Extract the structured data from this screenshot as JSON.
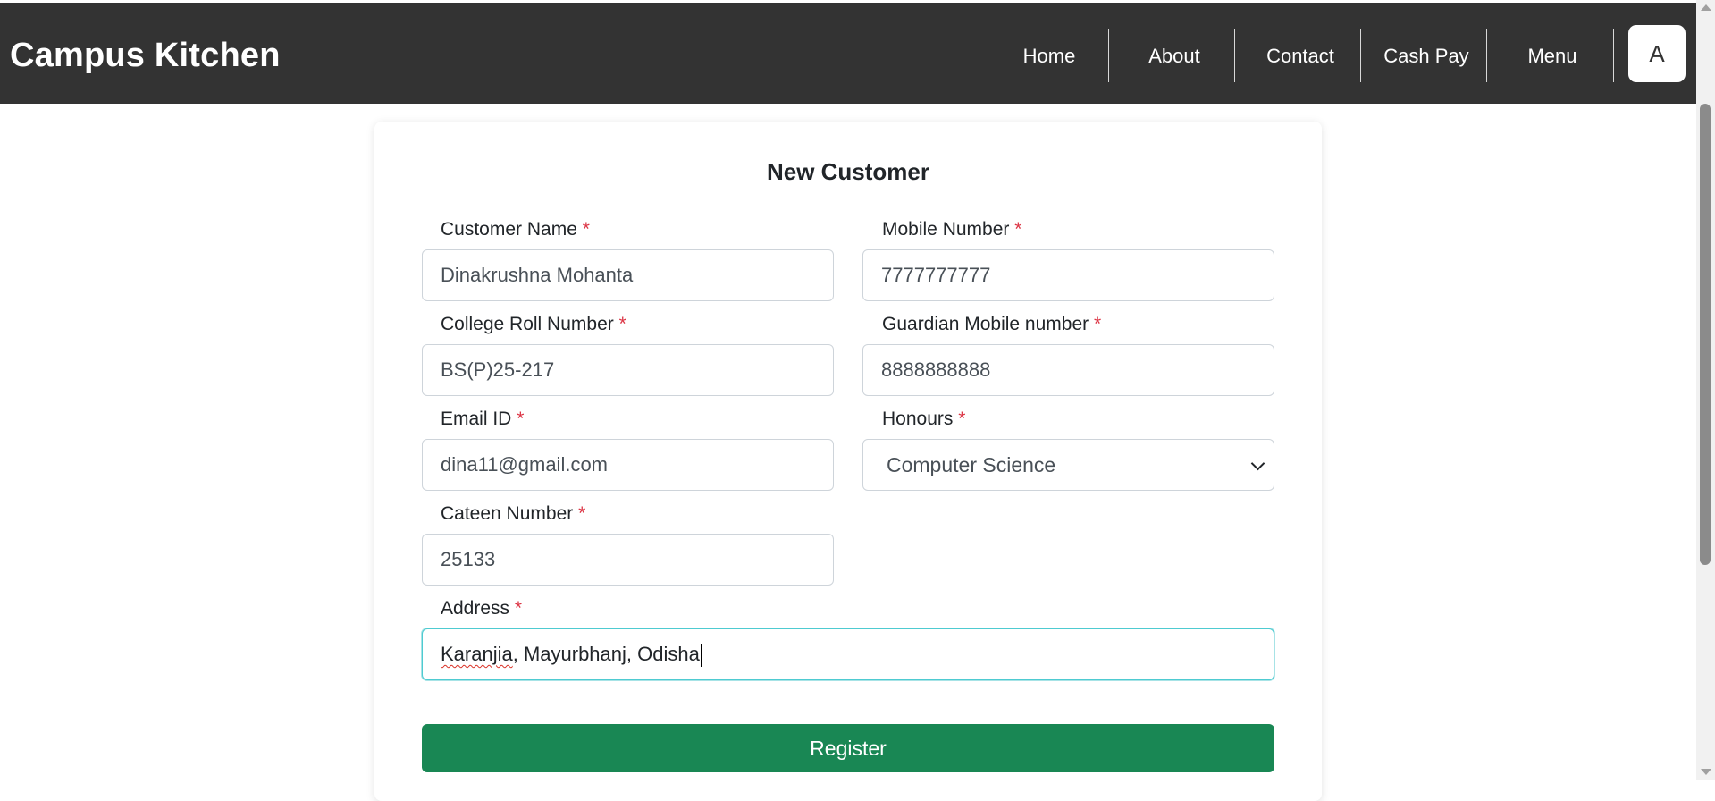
{
  "navbar": {
    "brand": "Campus Kitchen",
    "links": [
      "Home",
      "About",
      "Contact",
      "Cash Pay",
      "Menu"
    ],
    "avatar_letter": "A"
  },
  "form": {
    "title": "New Customer",
    "required_marker": "*",
    "fields": {
      "customer_name": {
        "label": "Customer Name",
        "value": "Dinakrushna Mohanta"
      },
      "mobile_number": {
        "label": "Mobile Number",
        "value": "7777777777"
      },
      "roll_number": {
        "label": "College Roll Number",
        "value": "BS(P)25-217"
      },
      "guardian_mobile": {
        "label": "Guardian Mobile number",
        "value": "8888888888"
      },
      "email": {
        "label": "Email ID",
        "value": "dina11@gmail.com"
      },
      "honours": {
        "label": "Honours",
        "value": "Computer Science"
      },
      "canteen_number": {
        "label": "Cateen Number",
        "value": "25133"
      },
      "address": {
        "label": "Address",
        "value_word1": "Karanjia",
        "value_rest": ", Mayurbhanj, Odisha"
      }
    },
    "submit_label": "Register"
  },
  "colors": {
    "navbar_bg": "#333333",
    "primary_button": "#198754",
    "required": "#dc3545",
    "focus_border": "#4ecbd1"
  }
}
